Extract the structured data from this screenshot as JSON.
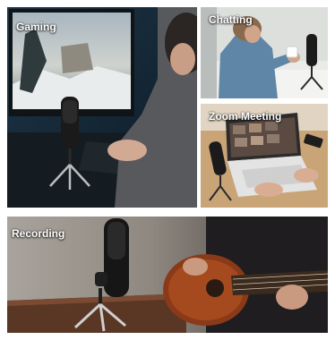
{
  "panels": {
    "gaming": {
      "label": "Gaming"
    },
    "chatting": {
      "label": "Chatting"
    },
    "zoom": {
      "label": "Zoom Meeting"
    },
    "recording": {
      "label": "Recording"
    }
  }
}
